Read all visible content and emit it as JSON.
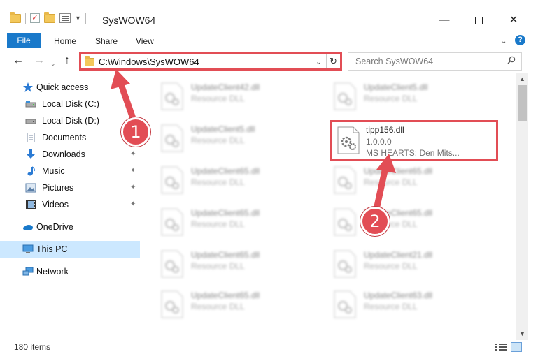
{
  "window": {
    "title": "SysWOW64",
    "minimize_glyph": "—",
    "close_glyph": "✕"
  },
  "ribbon": {
    "tabs": [
      "File",
      "Home",
      "Share",
      "View"
    ],
    "expand_glyph": "⌄",
    "help_glyph": "?"
  },
  "nav": {
    "back_glyph": "←",
    "forward_glyph": "→",
    "recent_glyph": "⌄",
    "up_glyph": "↑",
    "address": "C:\\Windows\\SysWOW64",
    "address_dropdown_glyph": "⌄",
    "refresh_glyph": "↻",
    "search_placeholder": "Search SysWOW64"
  },
  "sidebar": {
    "items": [
      {
        "label": "Quick access",
        "icon": "star-icon"
      },
      {
        "label": "Local Disk (C:)",
        "icon": "drive-icon"
      },
      {
        "label": "Local Disk (D:)",
        "icon": "drive-icon"
      },
      {
        "label": "Documents",
        "icon": "documents-icon"
      },
      {
        "label": "Downloads",
        "icon": "download-icon"
      },
      {
        "label": "Music",
        "icon": "music-icon"
      },
      {
        "label": "Pictures",
        "icon": "pictures-icon"
      },
      {
        "label": "Videos",
        "icon": "videos-icon"
      },
      {
        "label": "OneDrive",
        "icon": "cloud-icon"
      },
      {
        "label": "This PC",
        "icon": "computer-icon"
      },
      {
        "label": "Network",
        "icon": "network-icon"
      }
    ],
    "pin_glyph": "📌"
  },
  "files": [
    {
      "name": "UpdateClient42.dll",
      "line1": "Resource DLL",
      "line2": ""
    },
    {
      "name": "UpdateClient5.dll",
      "line1": "Resource DLL",
      "line2": ""
    },
    {
      "name": "UpdateClient5.dll",
      "line1": "Resource DLL",
      "line2": ""
    },
    {
      "name": "tipp156.dll",
      "line1": "1.0.0.0",
      "line2": "MS HEARTS: Den Mits..."
    },
    {
      "name": "UpdateClient65.dll",
      "line1": "Resource DLL",
      "line2": ""
    },
    {
      "name": "UpdateClient65.dll",
      "line1": "Resource DLL",
      "line2": ""
    },
    {
      "name": "UpdateClient65.dll",
      "line1": "Resource DLL",
      "line2": ""
    },
    {
      "name": "UpdateClient65.dll",
      "line1": "Resource DLL",
      "line2": ""
    },
    {
      "name": "UpdateClient65.dll",
      "line1": "Resource DLL",
      "line2": ""
    },
    {
      "name": "UpdateClient21.dll",
      "line1": "Resource DLL",
      "line2": ""
    },
    {
      "name": "UpdateClient65.dll",
      "line1": "Resource DLL",
      "line2": ""
    },
    {
      "name": "UpdateClient63.dll",
      "line1": "Resource DLL",
      "line2": ""
    }
  ],
  "status": {
    "item_count": "180 items"
  },
  "annotations": {
    "step1": "1",
    "step2": "2",
    "highlight_color": "#e24d55"
  },
  "colors": {
    "accent": "#1979ca",
    "selection": "#cce8ff",
    "annotation_red": "#e24d55"
  }
}
